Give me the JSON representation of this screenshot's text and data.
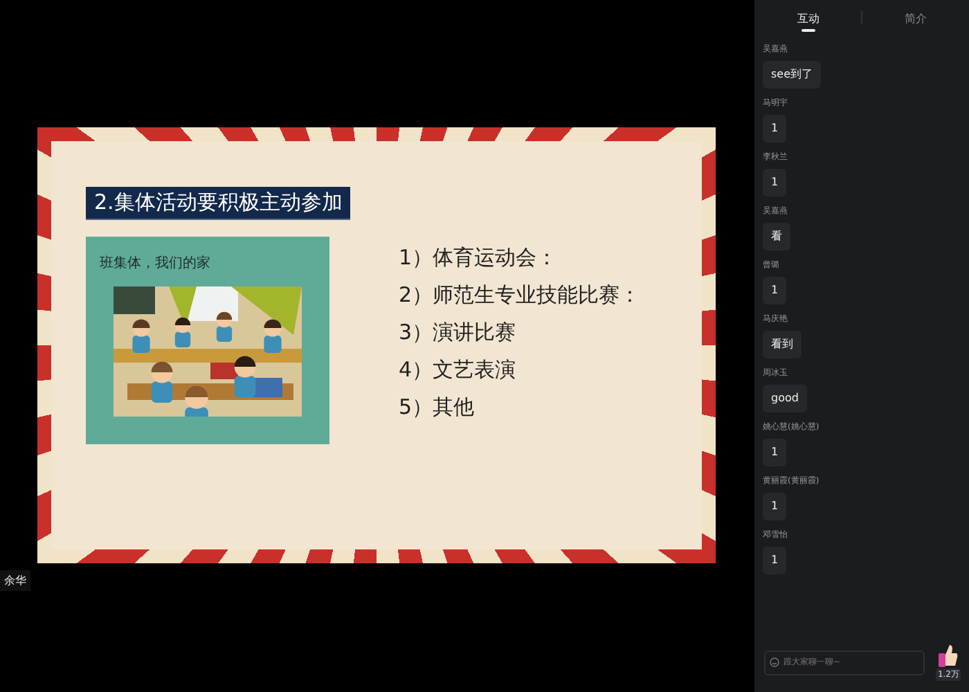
{
  "slide": {
    "title": "2.集体活动要积极主动参加",
    "caption": "班集体，我们的家",
    "items": [
      "1）体育运动会：",
      "2）师范生专业技能比赛：",
      "3）演讲比赛",
      "4）文艺表演",
      "5）其他"
    ]
  },
  "speaker": {
    "name": "余华"
  },
  "tabs": [
    {
      "label": "互动",
      "selected": true
    },
    {
      "label": "简介",
      "selected": false
    }
  ],
  "messages": [
    {
      "user": "吴嘉燕",
      "text": "see到了"
    },
    {
      "user": "马明宇",
      "text": "1"
    },
    {
      "user": "李秋兰",
      "text": "1"
    },
    {
      "user": "吴嘉燕",
      "text": "看"
    },
    {
      "user": "曾璐",
      "text": "1"
    },
    {
      "user": "马庆艳",
      "text": "看到"
    },
    {
      "user": "周冰玉",
      "text": "good"
    },
    {
      "user": "姚心慧(姚心慧)",
      "text": "1"
    },
    {
      "user": "黄丽霞(黄丽霞)",
      "text": "1"
    },
    {
      "user": "邓雪怡",
      "text": "1"
    }
  ],
  "composer": {
    "placeholder": "跟大家聊一聊~"
  },
  "likes": {
    "count": "1.2万"
  }
}
